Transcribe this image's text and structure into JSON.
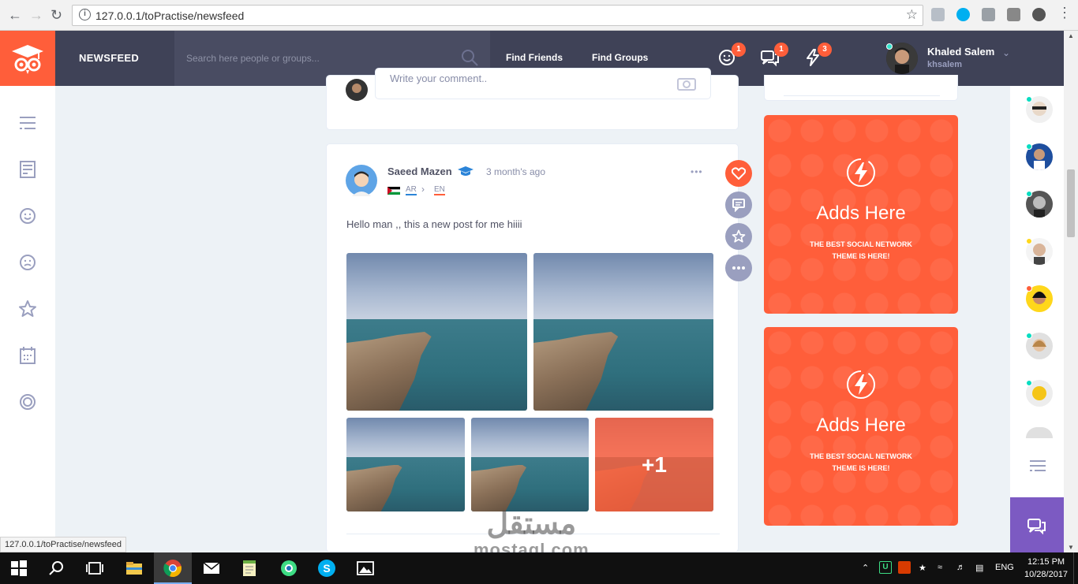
{
  "browser": {
    "url": "127.0.0.1/toPractise/newsfeed",
    "status_url": "127.0.0.1/toPractise/newsfeed"
  },
  "header": {
    "title": "NEWSFEED",
    "search_placeholder": "Search here people or groups...",
    "links": [
      "Find Friends",
      "Find Groups"
    ],
    "notifications": {
      "friends": "1",
      "messages": "1",
      "activity": "3"
    },
    "user_name": "Khaled Salem",
    "user_handle": "khsalem"
  },
  "comment": {
    "placeholder": "Write your comment.."
  },
  "post": {
    "author": "Saeed Mazen",
    "time": "3 month's ago",
    "lang_from": "AR",
    "lang_to": "EN",
    "text": "Hello man ,, this a new post for me hiiii",
    "more_photos": "+1",
    "menu": "•••"
  },
  "ads": [
    {
      "title": "Adds Here",
      "line1": "THE BEST SOCIAL NETWORK",
      "line2": "THEME IS HERE!"
    },
    {
      "title": "Adds Here",
      "line1": "THE BEST SOCIAL NETWORK",
      "line2": "THEME IS HERE!"
    }
  ],
  "taskbar": {
    "language": "ENG",
    "time": "12:15 PM",
    "date": "10/28/2017"
  },
  "watermark": {
    "arabic": "مستقل",
    "latin": "mostaql.com"
  },
  "colors": {
    "accent": "#ff5e3a",
    "header": "#3f4257",
    "purple": "#7c5ac2",
    "online": "#32e4cd"
  }
}
